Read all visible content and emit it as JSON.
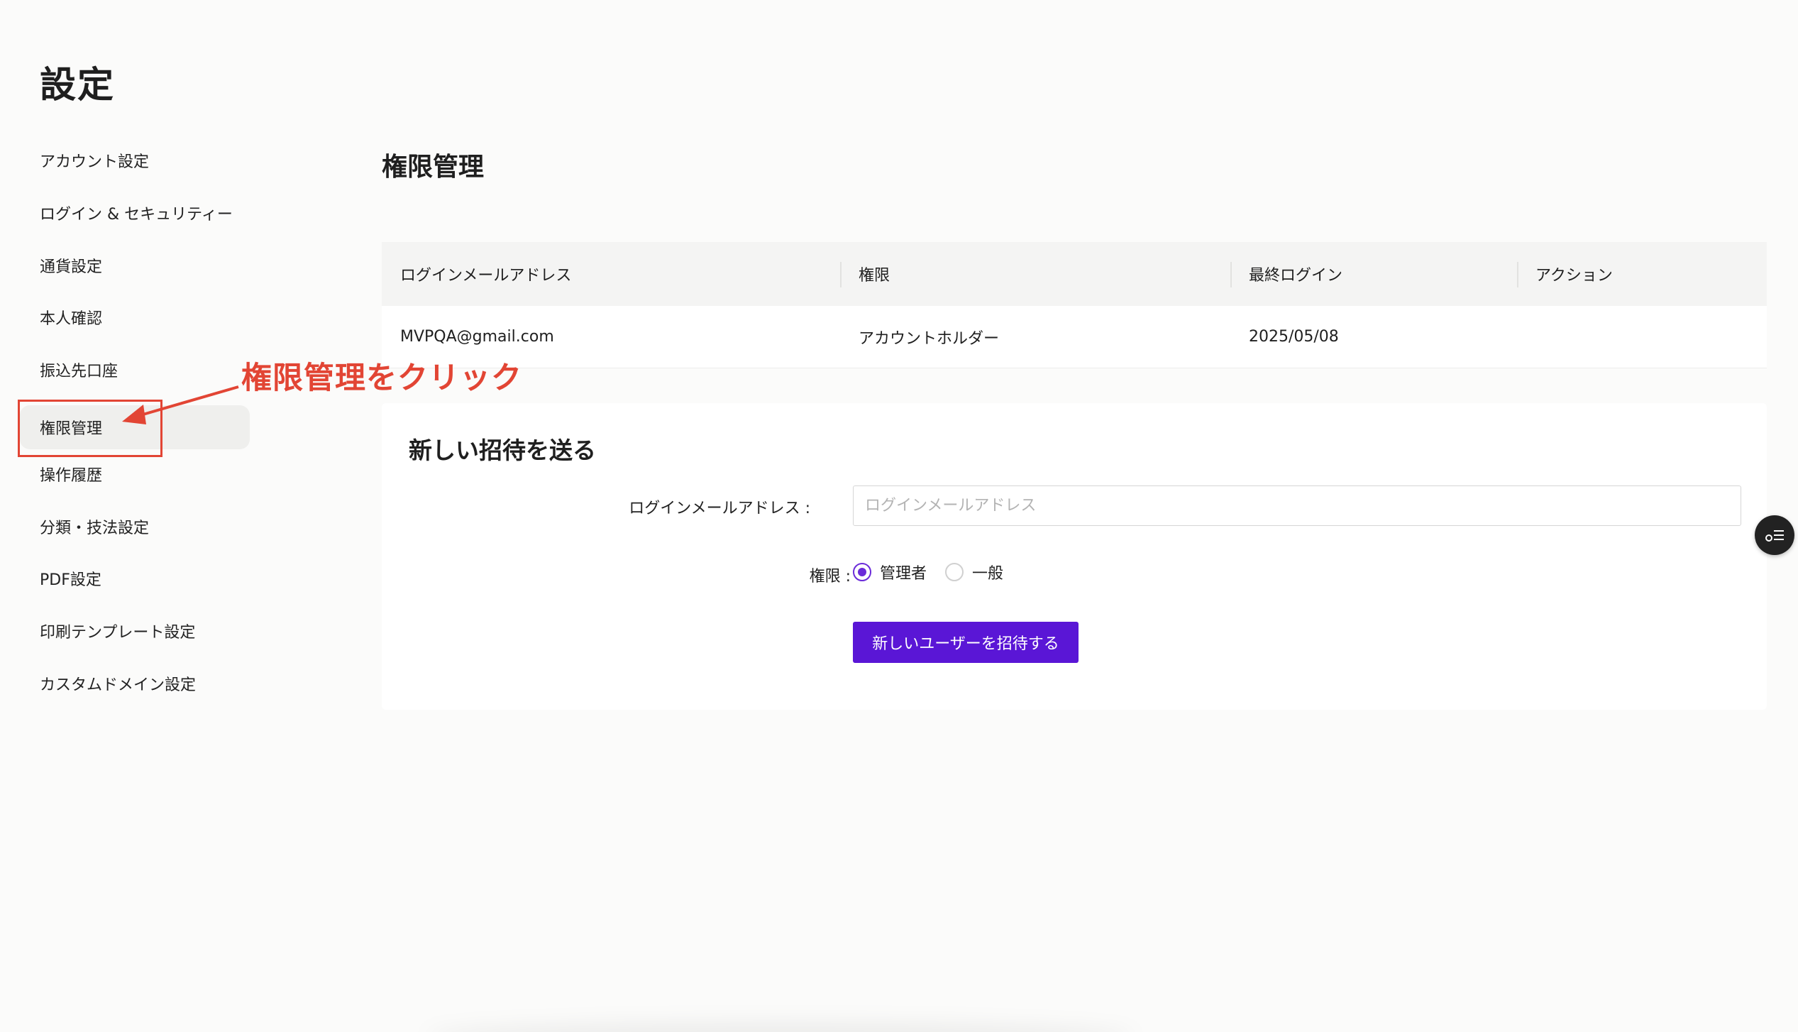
{
  "page": {
    "title": "設定"
  },
  "sidebar": {
    "items": [
      {
        "label": "アカウント設定"
      },
      {
        "label": "ログイン & セキュリティー"
      },
      {
        "label": "通貨設定"
      },
      {
        "label": "本人確認"
      },
      {
        "label": "振込先口座"
      },
      {
        "label": "権限管理",
        "active": true
      },
      {
        "label": "操作履歴"
      },
      {
        "label": "分類・技法設定"
      },
      {
        "label": "PDF設定"
      },
      {
        "label": "印刷テンプレート設定"
      },
      {
        "label": "カスタムドメイン設定"
      }
    ]
  },
  "main": {
    "title": "権限管理",
    "table": {
      "headers": [
        "ログインメールアドレス",
        "権限",
        "最終ログイン",
        "アクション"
      ],
      "rows": [
        {
          "email": "MVPQA@gmail.com",
          "role": "アカウントホルダー",
          "last_login": "2025/05/08",
          "action": ""
        }
      ]
    },
    "invite": {
      "title": "新しい招待を送る",
      "email_label": "ログインメールアドレス :",
      "email_placeholder": "ログインメールアドレス",
      "email_value": "",
      "role_label": "権限 :",
      "roles": [
        {
          "label": "管理者",
          "checked": true
        },
        {
          "label": "一般",
          "checked": false
        }
      ],
      "button_label": "新しいユーザーを招待する"
    }
  },
  "annotation": {
    "text": "権限管理をクリック",
    "color": "#e24534"
  },
  "floating": {
    "icon": "key-list-icon"
  },
  "colors": {
    "accent": "#5a16d6",
    "radio": "#6b2bd9",
    "annotation": "#e24534"
  }
}
